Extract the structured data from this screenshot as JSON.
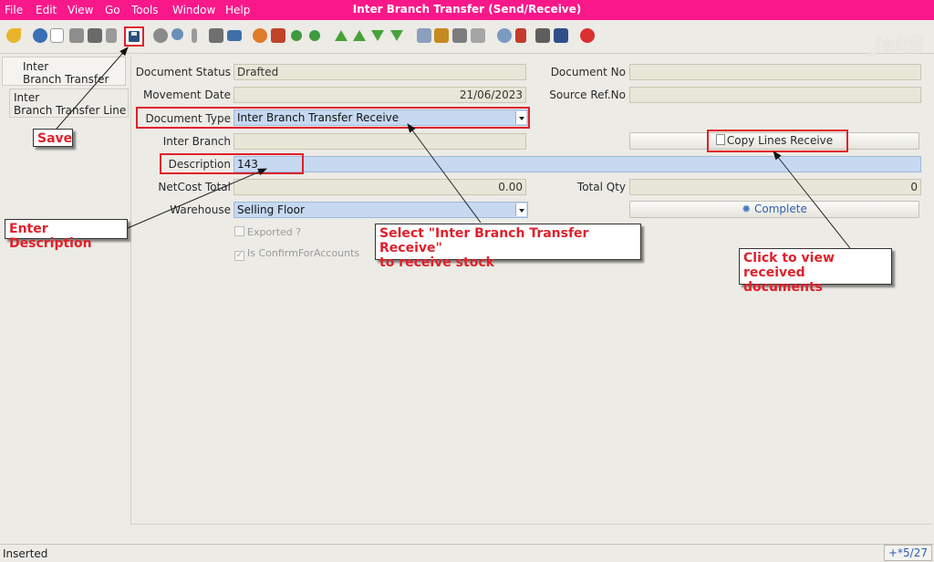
{
  "window": {
    "title": "Inter Branch Transfer (Send/Receive)",
    "menu": [
      "File",
      "Edit",
      "View",
      "Go",
      "Tools",
      "Window",
      "Help"
    ],
    "logo": "Jaldi"
  },
  "toolbar": {
    "icons": [
      "undo-icon",
      "help-icon",
      "new-icon",
      "copy-icon",
      "delete-icon",
      "delete-selection-icon",
      "save-icon",
      "refresh-icon",
      "find-icon",
      "attachment-icon",
      "chat-icon",
      "grid-toggle-icon",
      "history-icon",
      "home-icon",
      "previous-icon",
      "next-icon",
      "first-record-icon",
      "parent-record-icon",
      "detail-record-icon",
      "last-record-icon",
      "report-icon",
      "archive-icon",
      "print-icon",
      "print-preview-icon",
      "zoom-across-icon",
      "workflow-icon",
      "request-icon",
      "product-info-icon",
      "close-icon"
    ]
  },
  "tabs": [
    {
      "line1": "Inter",
      "line2": "Branch Transfer"
    },
    {
      "line1": "Inter",
      "line2": "Branch Transfer Line"
    }
  ],
  "form": {
    "document_status_label": "Document Status",
    "document_status_value": "Drafted",
    "document_no_label": "Document No",
    "document_no_value": "",
    "movement_date_label": "Movement Date",
    "movement_date_value": "21/06/2023",
    "source_ref_label": "Source Ref.No",
    "source_ref_value": "",
    "document_type_label": "Document Type",
    "document_type_value": "Inter Branch Transfer Receive",
    "inter_branch_label": "Inter Branch",
    "inter_branch_value": "",
    "copy_lines_button": "Copy Lines Receive",
    "description_label": "Description",
    "description_value": "143",
    "netcost_label": "NetCost Total",
    "netcost_value": "0.00",
    "total_qty_label": "Total Qty",
    "total_qty_value": "0",
    "warehouse_label": "Warehouse",
    "warehouse_value": "Selling Floor",
    "complete_button": "Complete",
    "exported_label": "Exported ?",
    "confirm_label": "Is ConfirmForAccounts"
  },
  "annotations": {
    "save": "Save",
    "enter_description": "Enter Description",
    "select_receive_line1": "Select \"Inter Branch Transfer Receive\"",
    "select_receive_line2": "to receive stock",
    "click_view_line1": "Click to view received",
    "click_view_line2": "documents"
  },
  "status": {
    "text": "Inserted",
    "count": "+*5/27"
  },
  "colors": {
    "titlebar": "#f9188a",
    "annotation_red": "#e0202a",
    "field_blue": "#c6d9f1"
  }
}
